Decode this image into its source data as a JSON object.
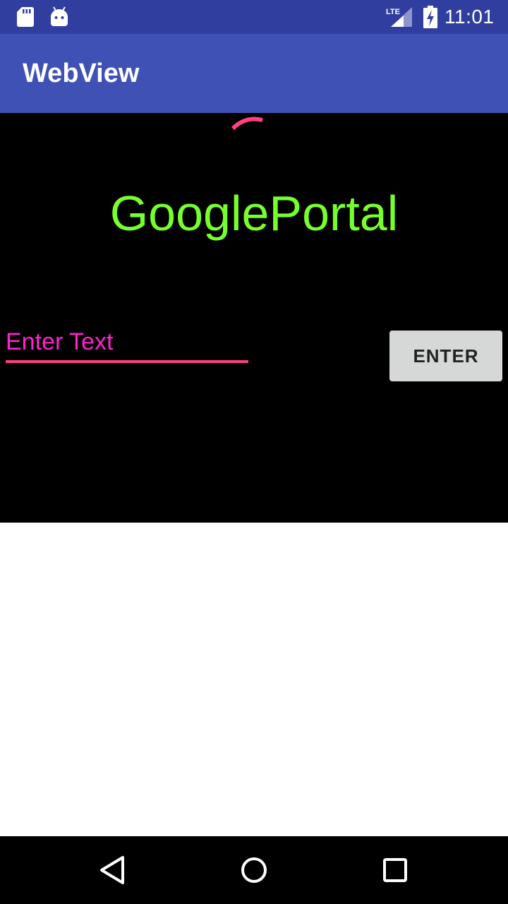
{
  "status_bar": {
    "time": "11:01",
    "network_label": "LTE",
    "icons": [
      "sd-card-icon",
      "android-icon",
      "lte-signal-icon",
      "battery-charging-icon"
    ],
    "background": "#303f9f"
  },
  "app_bar": {
    "title": "WebView",
    "background": "#3f51b5"
  },
  "content": {
    "heading": "GooglePortal",
    "heading_color": "#76ff2a",
    "input": {
      "value": "",
      "placeholder": "Enter Text"
    },
    "enter_button_label": "ENTER",
    "spinner_color": "#ff4081"
  },
  "nav_bar": {
    "buttons": [
      "back-icon",
      "home-icon",
      "recents-icon"
    ]
  }
}
